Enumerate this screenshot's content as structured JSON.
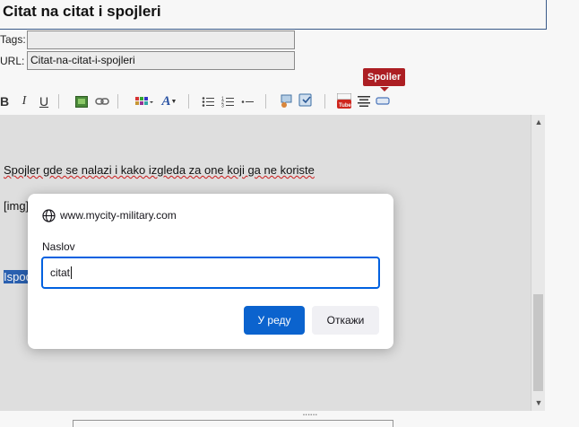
{
  "post": {
    "title": "Citat na citat i spojleri",
    "tags_label": "Tags:",
    "tags_value": "",
    "url_label": "URL:",
    "url_value": "Citat-na-citat-i-spojleri"
  },
  "toolbar": {
    "bold": "B",
    "italic": "I",
    "underline": "U",
    "font_letter": "A",
    "tooltip": "Spoiler",
    "icons": [
      "bold-icon",
      "italic-icon",
      "underline-icon",
      "image-icon",
      "link-icon",
      "table-icon",
      "font-color-icon",
      "unordered-list-icon",
      "ordered-list-icon",
      "horizontal-rule-icon",
      "quote-icon",
      "code-icon",
      "youtube-icon",
      "align-icon",
      "spoiler-icon"
    ]
  },
  "editor": {
    "line1": "Spojler gde se nalazi i kako izgleda za one koji ga ne koriste",
    "line2": "[img]",
    "selected_fragment": "Ispod"
  },
  "dialog": {
    "origin": "www.mycity-military.com",
    "label": "Naslov",
    "input_value": "citat",
    "ok_label": "У реду",
    "cancel_label": "Откажи"
  },
  "colors": {
    "tooltip_bg": "#b11e23",
    "primary_button": "#0b63ce",
    "input_focus": "#0061e0",
    "selection": "#2a62b6"
  }
}
